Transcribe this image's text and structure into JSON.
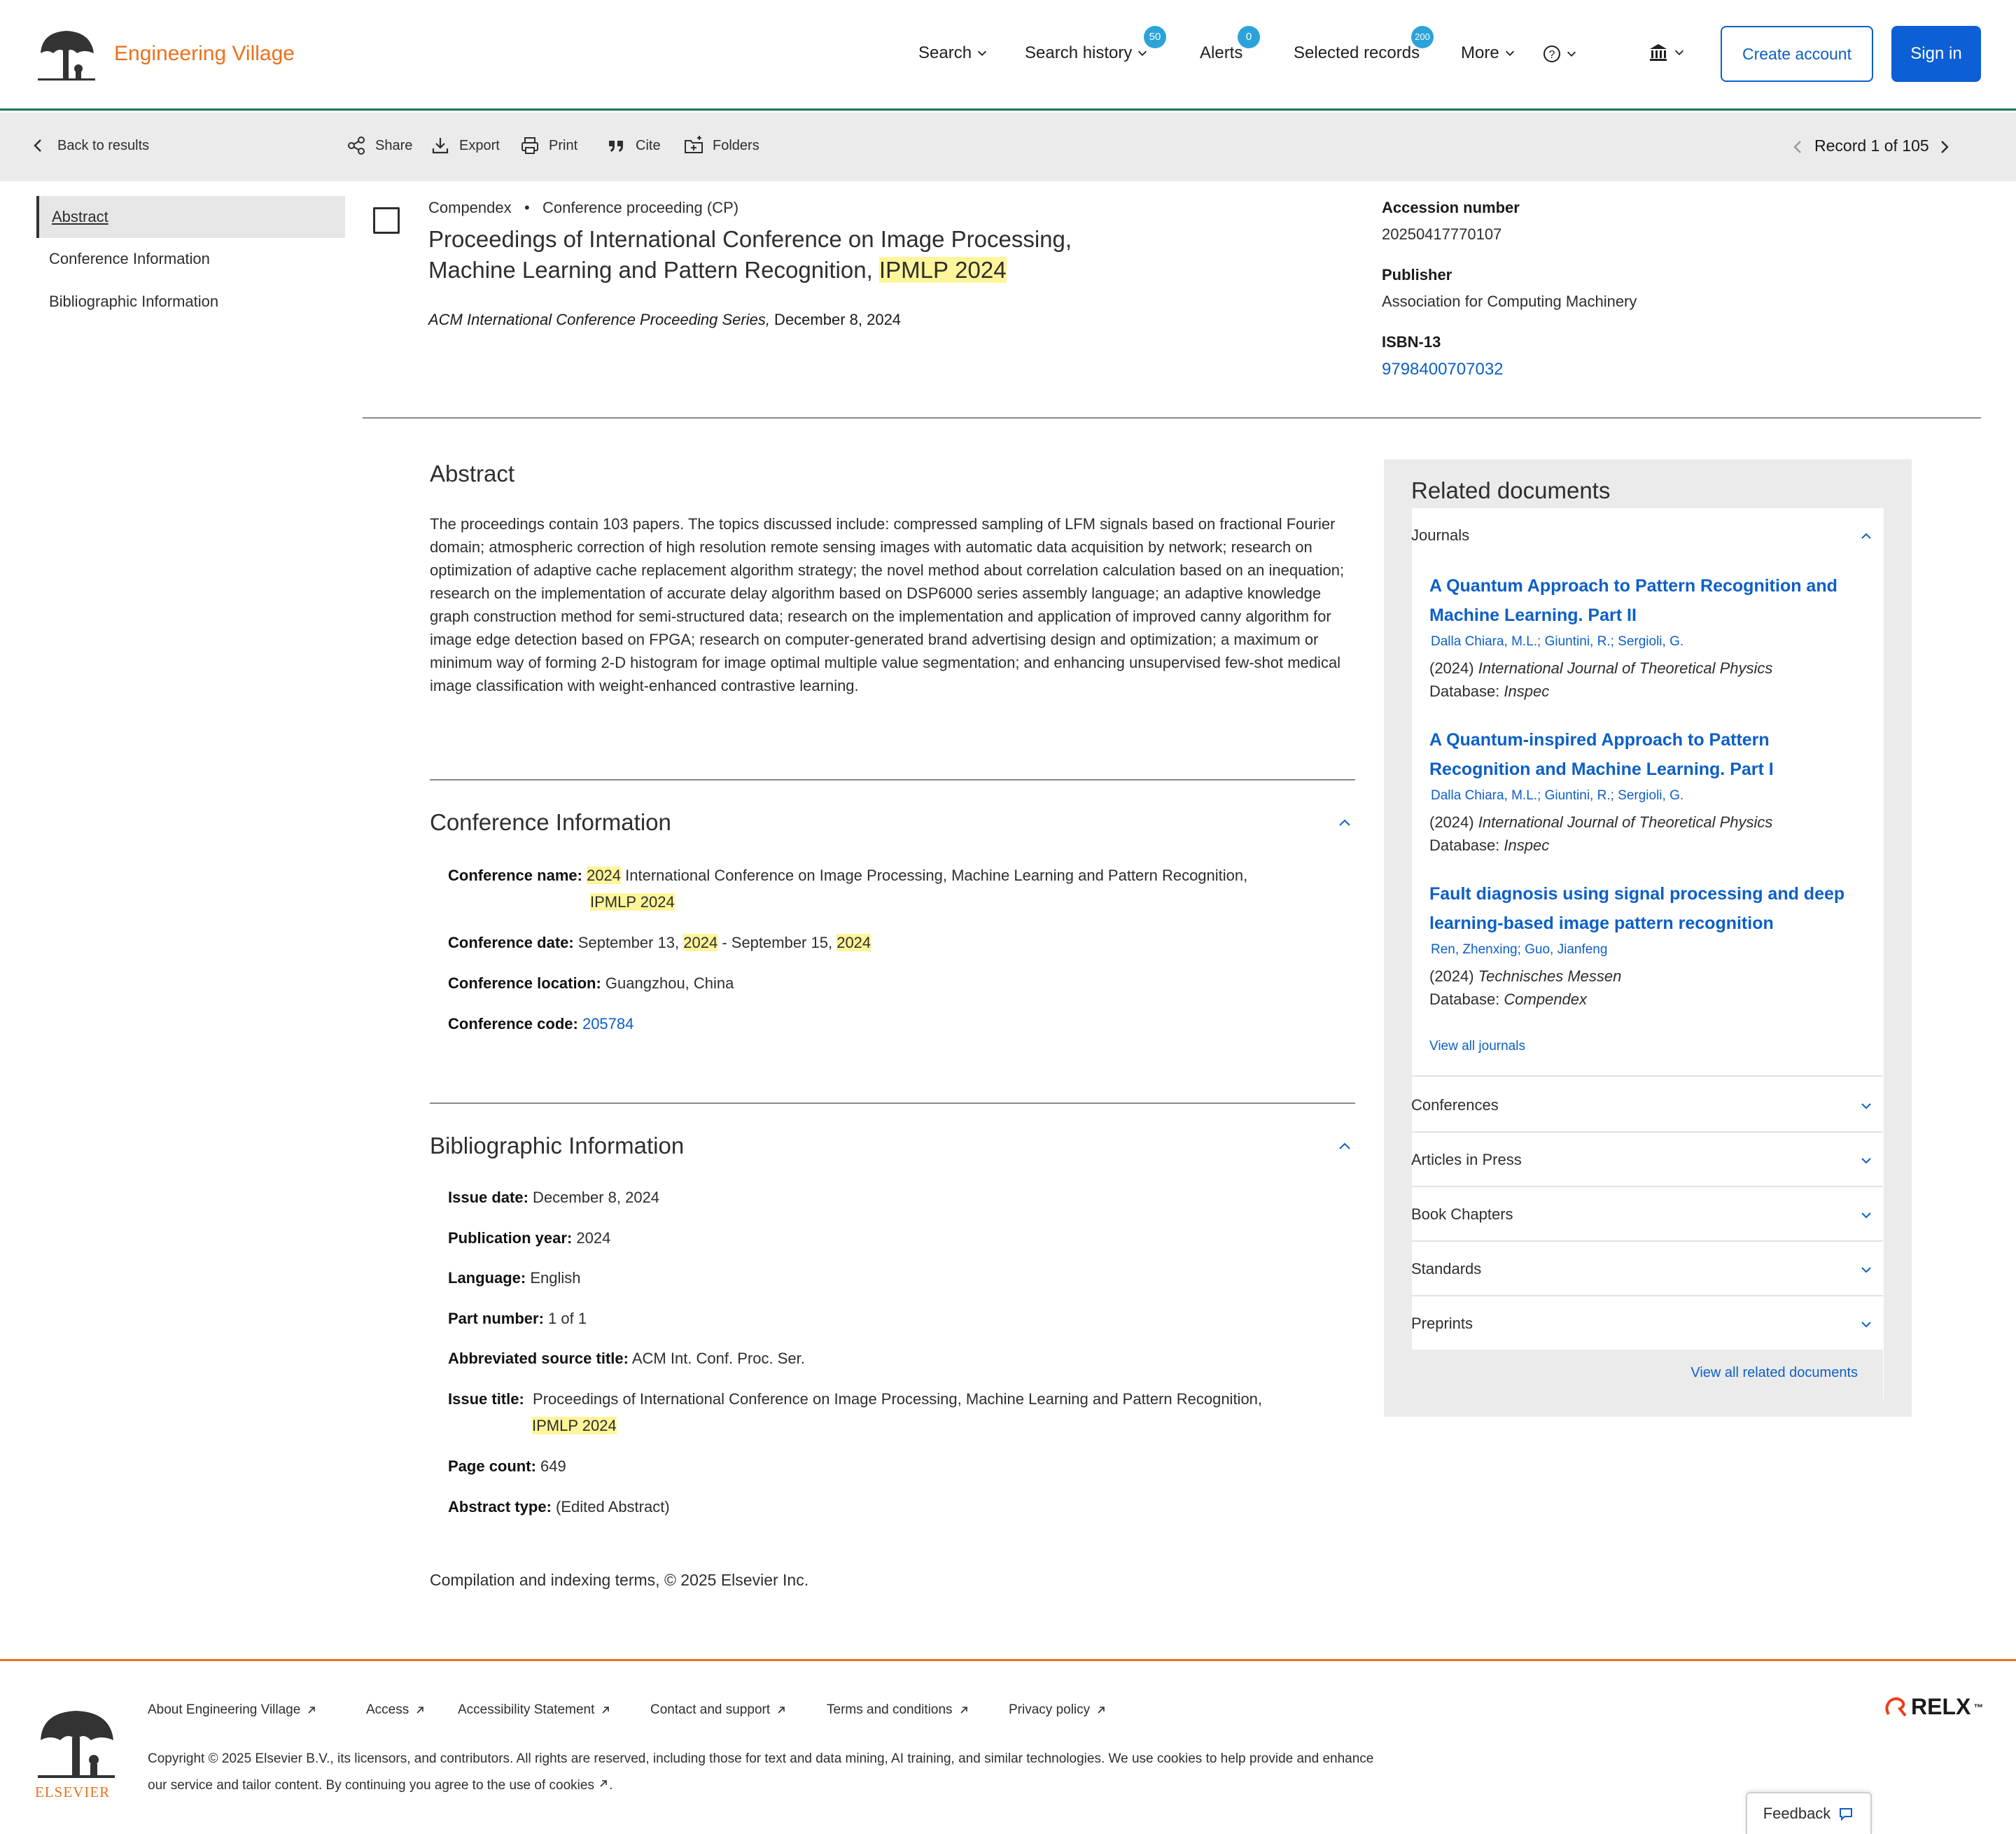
{
  "header": {
    "brand": "Engineering Village",
    "nav": {
      "search": "Search",
      "search_history": "Search history",
      "search_history_count": "50",
      "alerts": "Alerts",
      "alerts_count": "0",
      "selected_records": "Selected records",
      "selected_records_count": "200",
      "more": "More",
      "help": "?"
    },
    "create_account": "Create account",
    "sign_in": "Sign in"
  },
  "toolbar": {
    "back": "Back to results",
    "share": "Share",
    "export": "Export",
    "print": "Print",
    "cite": "Cite",
    "folders": "Folders",
    "record_position": "Record 1 of 105"
  },
  "left_nav": {
    "items": [
      "Abstract",
      "Conference Information",
      "Bibliographic Information"
    ]
  },
  "record": {
    "database": "Compendex",
    "doc_type": "Conference proceeding (CP)",
    "title_part1": "Proceedings of International Conference on Image Processing,",
    "title_part2": "Machine Learning and Pattern Recognition, ",
    "title_hl1": "IPMLP",
    "title_hl2": "2024",
    "series": "ACM International Conference Proceeding Series,",
    "series_date": " December 8, 2024",
    "accession_label": "Accession number",
    "accession_value": "20250417770107",
    "publisher_label": "Publisher",
    "publisher_value": "Association for Computing Machinery",
    "isbn_label": "ISBN-13",
    "isbn_value": "9798400707032"
  },
  "abstract": {
    "heading": "Abstract",
    "text": "The proceedings contain 103 papers. The topics discussed include: compressed sampling of LFM signals based on fractional Fourier domain; atmospheric correction of high resolution remote sensing images with automatic data acquisition by network; research on optimization of adaptive cache replacement algorithm strategy; the novel method about correlation calculation based on an inequation; research on the implementation of accurate delay algorithm based on DSP6000 series assembly language; an adaptive knowledge graph construction method for semi-structured data; research on the implementation and application of improved canny algorithm for image edge detection based on FPGA; research on computer-generated brand advertising design and optimization; a maximum or minimum way of forming 2-D histogram for image optimal multiple value segmentation; and enhancing unsupervised few-shot medical image classification with weight-enhanced contrastive learning."
  },
  "conference": {
    "heading": "Conference Information",
    "name_label": "Conference name:",
    "name_hl_year": "2024",
    "name_text": " International Conference on Image Processing, Machine Learning and Pattern Recognition,",
    "name_hl_acronym": "IPMLP 2024",
    "date_label": "Conference date:",
    "date_start": " September 13, ",
    "date_year1": "2024",
    "date_mid": " - September 15, ",
    "date_year2": "2024",
    "location_label": "Conference location:",
    "location_value": " Guangzhou, China",
    "code_label": "Conference code:",
    "code_value": "205784"
  },
  "bibliographic": {
    "heading": "Bibliographic Information",
    "fields": [
      {
        "label": "Issue date:",
        "value": " December 8, 2024"
      },
      {
        "label": "Publication year:",
        "value": " 2024"
      },
      {
        "label": "Language:",
        "value": " English"
      },
      {
        "label": "Part number:",
        "value": " 1 of 1"
      },
      {
        "label": "Abbreviated source title:",
        "value": " ACM Int. Conf. Proc. Ser."
      }
    ],
    "issue_title_label": "Issue title:",
    "issue_title_value": "Proceedings of International Conference on Image Processing, Machine Learning and Pattern Recognition,",
    "issue_title_hl": "IPMLP 2024",
    "page_count_label": "Page count:",
    "page_count_value": " 649",
    "abstract_type_label": "Abstract type:",
    "abstract_type_value": " (Edited Abstract)"
  },
  "footnote": "Compilation and indexing terms, © 2025 Elsevier Inc.",
  "related": {
    "heading": "Related documents",
    "journals_label": "Journals",
    "documents": [
      {
        "title": "A Quantum Approach to Pattern Recognition and Machine Learning. Part II",
        "authors": "Dalla Chiara, M.L.; Giuntini, R.; Sergioli, G.",
        "year": "(2024) ",
        "source": "International Journal of Theoretical Physics",
        "database_label": "Database: ",
        "database": "Inspec"
      },
      {
        "title": "A Quantum-inspired Approach to Pattern Recognition and Machine Learning. Part I",
        "authors": "Dalla Chiara, M.L.; Giuntini, R.; Sergioli, G.",
        "year": "(2024) ",
        "source": "International Journal of Theoretical Physics",
        "database_label": "Database: ",
        "database": "Inspec"
      },
      {
        "title": "Fault diagnosis using signal processing and deep learning-based image pattern recognition",
        "authors": "Ren, Zhenxing; Guo, Jianfeng",
        "year": "(2024) ",
        "source": "Technisches Messen",
        "database_label": "Database: ",
        "database": "Compendex"
      }
    ],
    "view_all_journals": "View all journals",
    "categories": [
      "Conferences",
      "Articles in Press",
      "Book Chapters",
      "Standards",
      "Preprints"
    ],
    "view_all_related": "View all related documents"
  },
  "footer": {
    "links": [
      "About Engineering Village",
      "Access",
      "Accessibility Statement",
      "Contact and support",
      "Terms and conditions",
      "Privacy policy"
    ],
    "copyright": "Copyright © 2025 Elsevier B.V., its licensors, and contributors. All rights are reserved, including those for text and data mining, AI training, and similar technologies. We use cookies to help provide and enhance our service and tailor content. By continuing you agree to the use of cookies",
    "elsevier": "ELSEVIER",
    "relx": "RELX",
    "relx_tm": "™",
    "feedback": "Feedback"
  },
  "colors": {
    "brand_orange": "#e9711c",
    "link_blue": "#0c5fc7",
    "header_rule_green": "#17775c",
    "highlight": "#fff59a",
    "badge_blue": "#2ba3d9"
  }
}
